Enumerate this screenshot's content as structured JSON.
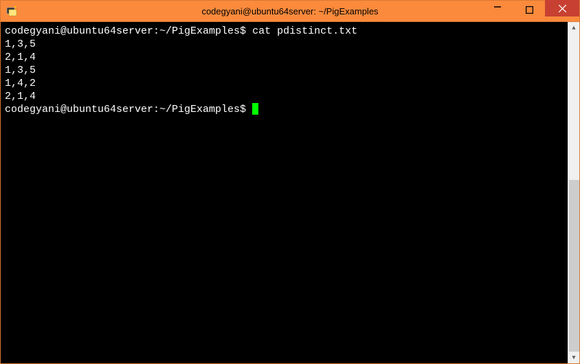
{
  "window": {
    "title": "codegyani@ubuntu64server: ~/PigExamples"
  },
  "terminal": {
    "prompt": "codegyani@ubuntu64server:~/PigExamples$",
    "command": "cat pdistinct.txt",
    "output": [
      "1,3,5",
      "2,1,4",
      "1,3,5",
      "1,4,2",
      "2,1,4"
    ],
    "prompt2": "codegyani@ubuntu64server:~/PigExamples$"
  }
}
